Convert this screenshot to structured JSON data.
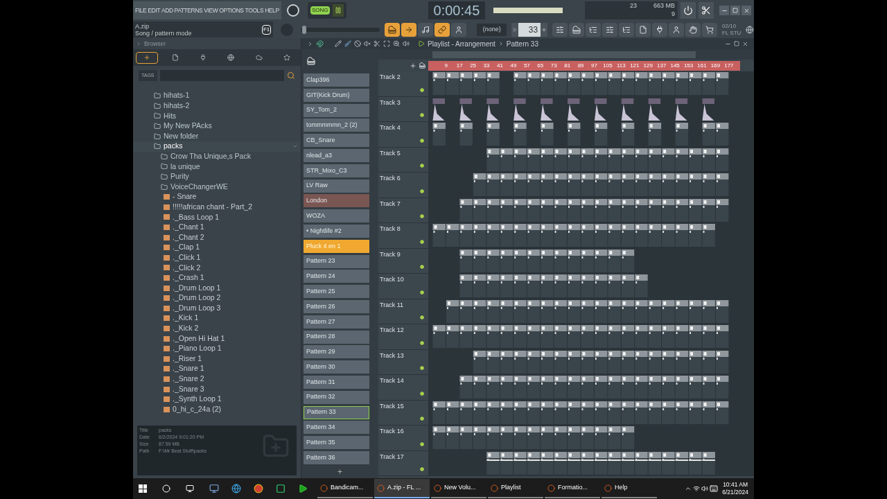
{
  "menu": [
    "FILE",
    "EDIT",
    "ADD",
    "PATTERNS",
    "VIEW",
    "OPTIONS",
    "TOOLS",
    "HELP"
  ],
  "transport": {
    "mode": "SONG",
    "song_mode": true,
    "time": "0:00:45"
  },
  "monitor": {
    "cpu": "23",
    "memory": "663 MB",
    "polyphony": "9"
  },
  "hint": {
    "title": "A.zip",
    "text": "Song / pattern mode",
    "key": "F1"
  },
  "master_pitch": {
    "level": 0.02
  },
  "snap": "(none)",
  "pattern_number": "33",
  "news": {
    "count": "02/10",
    "title": "FL STU"
  },
  "browser": {
    "title": "Browser",
    "tags_label": "TAGS",
    "tabs": [
      {
        "kind": "all",
        "selected": true
      },
      {
        "kind": "files",
        "selected": false
      },
      {
        "kind": "plugins",
        "selected": false
      },
      {
        "kind": "web",
        "selected": false
      },
      {
        "kind": "cloud",
        "selected": false
      },
      {
        "kind": "favorites",
        "selected": false
      }
    ],
    "tree": [
      {
        "kind": "folder",
        "name": "hihats-1",
        "selected": false,
        "expanded": false
      },
      {
        "kind": "folder",
        "name": "hihats-2",
        "selected": false,
        "expanded": false
      },
      {
        "kind": "folder",
        "name": "Hits",
        "selected": false,
        "expanded": false
      },
      {
        "kind": "folder",
        "name": "My New PAcks",
        "selected": false,
        "expanded": false
      },
      {
        "kind": "folder",
        "name": "New folder",
        "selected": false,
        "expanded": false
      },
      {
        "kind": "folder",
        "name": "packs",
        "selected": true,
        "expanded": true,
        "children": [
          {
            "kind": "folder",
            "name": "Crow Tha Unique,s Pack",
            "selected": false,
            "expanded": false
          },
          {
            "kind": "folder",
            "name": "la unique",
            "selected": false,
            "expanded": false
          },
          {
            "kind": "folder",
            "name": "Purity",
            "selected": false,
            "expanded": false
          },
          {
            "kind": "folder",
            "name": "VoiceChangerWE",
            "selected": false,
            "expanded": false
          },
          {
            "kind": "file",
            "name": "- Snare",
            "selected": false,
            "expanded": false
          },
          {
            "kind": "file",
            "name": "!!!!!african chant - Part_2",
            "selected": false,
            "expanded": false
          },
          {
            "kind": "file",
            "name": "._Bass Loop 1",
            "selected": false,
            "expanded": false
          },
          {
            "kind": "file",
            "name": "._Chant 1",
            "selected": false,
            "expanded": false
          },
          {
            "kind": "file",
            "name": "._Chant 2",
            "selected": false,
            "expanded": false
          },
          {
            "kind": "file",
            "name": "._Clap 1",
            "selected": false,
            "expanded": false
          },
          {
            "kind": "file",
            "name": "._Click 1",
            "selected": false,
            "expanded": false
          },
          {
            "kind": "file",
            "name": "._Click 2",
            "selected": false,
            "expanded": false
          },
          {
            "kind": "file",
            "name": "._Crash 1",
            "selected": false,
            "expanded": false
          },
          {
            "kind": "file",
            "name": "._Drum Loop 1",
            "selected": false,
            "expanded": false
          },
          {
            "kind": "file",
            "name": "._Drum Loop 2",
            "selected": false,
            "expanded": false
          },
          {
            "kind": "file",
            "name": "._Drum Loop 3",
            "selected": false,
            "expanded": false
          },
          {
            "kind": "file",
            "name": "._Kick 1",
            "selected": false,
            "expanded": false
          },
          {
            "kind": "file",
            "name": "._Kick 2",
            "selected": false,
            "expanded": false
          },
          {
            "kind": "file",
            "name": "._Open Hi Hat 1",
            "selected": false,
            "expanded": false
          },
          {
            "kind": "file",
            "name": "._Piano Loop 1",
            "selected": false,
            "expanded": false
          },
          {
            "kind": "file",
            "name": "._Riser 1",
            "selected": false,
            "expanded": false
          },
          {
            "kind": "file",
            "name": "._Snare 1",
            "selected": false,
            "expanded": false
          },
          {
            "kind": "file",
            "name": "._Snare 2",
            "selected": false,
            "expanded": false
          },
          {
            "kind": "file",
            "name": "._Snare 3",
            "selected": false,
            "expanded": false
          },
          {
            "kind": "file",
            "name": "._Synth Loop 1",
            "selected": false,
            "expanded": false
          },
          {
            "kind": "file",
            "name": "0_hi_c_24a (2)",
            "selected": false,
            "expanded": false
          }
        ]
      }
    ],
    "info": [
      {
        "label": "Title",
        "value": "packs"
      },
      {
        "label": "Date",
        "value": "6/2/2024 9:01:20 PM"
      },
      {
        "label": "Size",
        "value": "87.59 MB"
      },
      {
        "label": "Path",
        "value": "F:\\Mr Beat Stuff\\packs"
      }
    ]
  },
  "patterns": [
    {
      "name": "Clap396",
      "color": "#5b6670",
      "selected": false
    },
    {
      "name": "GIT(Kick Drum)",
      "color": "#5b6670",
      "selected": false
    },
    {
      "name": "SY_Tom_2",
      "color": "#5b6670",
      "selected": false
    },
    {
      "name": "tommmmmn_2 (2)",
      "color": "#5b6670",
      "selected": false
    },
    {
      "name": "CB_Snare",
      "color": "#5b6670",
      "selected": false
    },
    {
      "name": "nlead_a3",
      "color": "#5b6670",
      "selected": false
    },
    {
      "name": "STR_Mixo_C3",
      "color": "#5b6670",
      "selected": false
    },
    {
      "name": "LV Raw",
      "color": "#5b6670",
      "selected": false
    },
    {
      "name": "London",
      "color": "#7a5652",
      "selected": false
    },
    {
      "name": "WOZA",
      "color": "#5b6670",
      "selected": false
    },
    {
      "name": "• Nightlife #2",
      "color": "#5b6670",
      "selected": false
    },
    {
      "name": "Pluck 4 en 1",
      "color": "#f0a830",
      "selected": false
    },
    {
      "name": "Pattern 23",
      "color": "#5b6670",
      "selected": false
    },
    {
      "name": "Pattern 24",
      "color": "#5b6670",
      "selected": false
    },
    {
      "name": "Pattern 25",
      "color": "#5b6670",
      "selected": false
    },
    {
      "name": "Pattern 26",
      "color": "#5b6670",
      "selected": false
    },
    {
      "name": "Pattern 27",
      "color": "#5b6670",
      "selected": false
    },
    {
      "name": "Pattern 28",
      "color": "#5b6670",
      "selected": false
    },
    {
      "name": "Pattern 29",
      "color": "#5b6670",
      "selected": false
    },
    {
      "name": "Pattern 30",
      "color": "#5b6670",
      "selected": false
    },
    {
      "name": "Pattern 31",
      "color": "#5b6670",
      "selected": false
    },
    {
      "name": "Pattern 32",
      "color": "#5b6670",
      "selected": false
    },
    {
      "name": "Pattern 33",
      "color": "#5b6670",
      "selected": true
    },
    {
      "name": "Pattern 34",
      "color": "#5b6670",
      "selected": false
    },
    {
      "name": "Pattern 35",
      "color": "#5b6670",
      "selected": false
    },
    {
      "name": "Pattern 36",
      "color": "#5b6670",
      "selected": false
    }
  ],
  "playlist": {
    "title": "Playlist - Arrangement",
    "pattern": "Pattern 33",
    "ruler": [
      "9",
      "17",
      "25",
      "33",
      "41",
      "49",
      "57",
      "65",
      "73",
      "81",
      "89",
      "97",
      "105",
      "113",
      "121",
      "129",
      "137",
      "145",
      "153",
      "161",
      "169",
      "177"
    ],
    "tracks": [
      {
        "name": "Track 2"
      },
      {
        "name": "Track 3"
      },
      {
        "name": "Track 4"
      },
      {
        "name": "Track 5"
      },
      {
        "name": "Track 6"
      },
      {
        "name": "Track 7"
      },
      {
        "name": "Track 8"
      },
      {
        "name": "Track 9"
      },
      {
        "name": "Track 10"
      },
      {
        "name": "Track 11"
      },
      {
        "name": "Track 12"
      },
      {
        "name": "Track 13"
      },
      {
        "name": "Track 14"
      },
      {
        "name": "Track 15"
      },
      {
        "name": "Track 16"
      },
      {
        "name": "Track 17"
      }
    ]
  },
  "taskbar": {
    "apps": [
      {
        "label": "Bandicam...",
        "selected": false
      },
      {
        "label": "A.zip - FL ...",
        "selected": true
      },
      {
        "label": "New Volu...",
        "selected": false
      },
      {
        "label": "Playlist",
        "selected": false
      },
      {
        "label": "Formatio...",
        "selected": false
      },
      {
        "label": "Help",
        "selected": false
      }
    ],
    "time": "10:41 AM",
    "date": "6/21/2024"
  }
}
